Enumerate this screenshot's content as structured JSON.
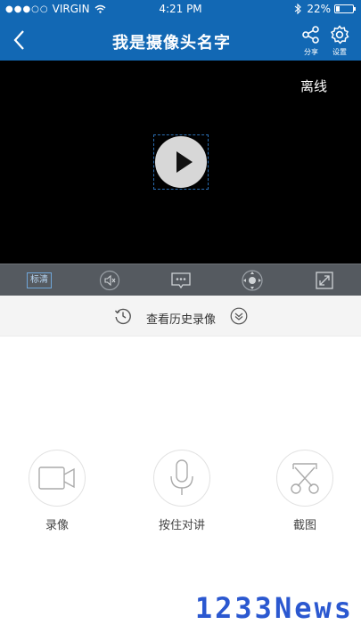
{
  "status_bar": {
    "signal": "●●●○○",
    "carrier": "VIRGIN",
    "time": "4:21 PM",
    "battery": "22%",
    "battery_level": 0.22
  },
  "nav": {
    "title": "我是摄像头名字",
    "share_label": "分享",
    "settings_label": "设置"
  },
  "video": {
    "status_text": "离线",
    "play_icon": "play-icon"
  },
  "controls": {
    "quality_label": "标清",
    "icons": [
      "mute-icon",
      "chat-icon",
      "ptz-icon",
      "fullscreen-icon"
    ]
  },
  "history": {
    "label": "查看历史录像"
  },
  "actions": [
    {
      "label": "录像",
      "icon": "video-record-icon"
    },
    {
      "label": "按住对讲",
      "icon": "microphone-icon"
    },
    {
      "label": "截图",
      "icon": "scissors-icon"
    }
  ],
  "watermark": "1233News",
  "colors": {
    "brand": "#1268b4",
    "control_bar": "#555a60",
    "watermark": "#2b58d0"
  }
}
